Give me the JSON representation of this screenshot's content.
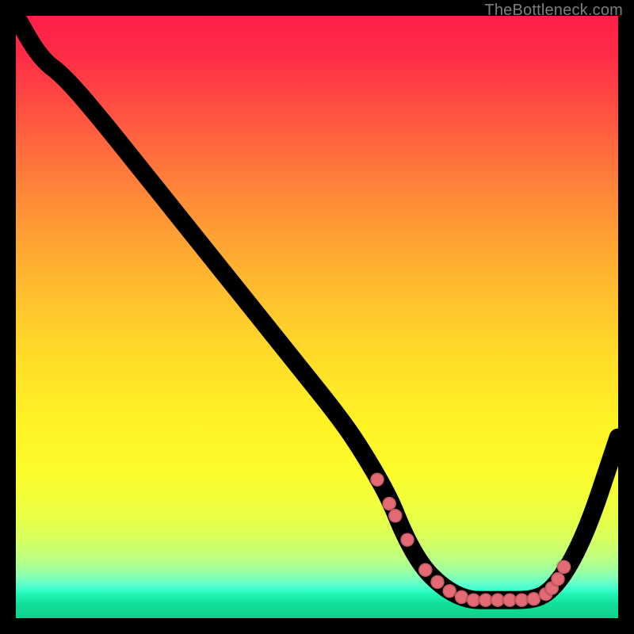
{
  "attribution": "TheBottleneck.com",
  "colors": {
    "background": "#000000",
    "line": "#000000",
    "dot": "#e46a75",
    "gradient_top": "#ff1f49",
    "gradient_bottom": "#0fd08b"
  },
  "chart_data": {
    "type": "line",
    "title": "",
    "xlabel": "",
    "ylabel": "",
    "xlim": [
      0,
      100
    ],
    "ylim": [
      0,
      100
    ],
    "series": [
      {
        "name": "bottleneck-curve",
        "x": [
          0,
          4,
          8,
          14,
          22,
          30,
          38,
          46,
          54,
          58,
          62,
          64,
          66,
          68,
          70,
          72,
          74,
          76,
          78,
          80,
          82,
          84,
          86,
          88,
          90,
          92,
          94,
          96,
          98,
          100
        ],
        "y": [
          100,
          93,
          90,
          83,
          73,
          63,
          53,
          43,
          33,
          27,
          20,
          15,
          11,
          8,
          6,
          4.5,
          3.5,
          3,
          3,
          3,
          3,
          3,
          3.2,
          4,
          6,
          9,
          13,
          18,
          24,
          30
        ]
      }
    ],
    "marker_points": {
      "name": "highlight-dots",
      "x": [
        60,
        62,
        63,
        65,
        68,
        70,
        72,
        74,
        76,
        78,
        80,
        82,
        84,
        86,
        88,
        89,
        90,
        91
      ],
      "y": [
        23,
        19,
        17,
        13,
        8,
        6,
        4.5,
        3.5,
        3,
        3,
        3,
        3,
        3,
        3.2,
        4,
        5,
        6.5,
        8.5
      ]
    },
    "gradient_bands": [
      {
        "pct": 0,
        "color": "#ff1f49"
      },
      {
        "pct": 50,
        "color": "#ffd32a"
      },
      {
        "pct": 75,
        "color": "#fcfb2a"
      },
      {
        "pct": 95,
        "color": "#20f7b6"
      },
      {
        "pct": 100,
        "color": "#0fd08b"
      }
    ]
  }
}
